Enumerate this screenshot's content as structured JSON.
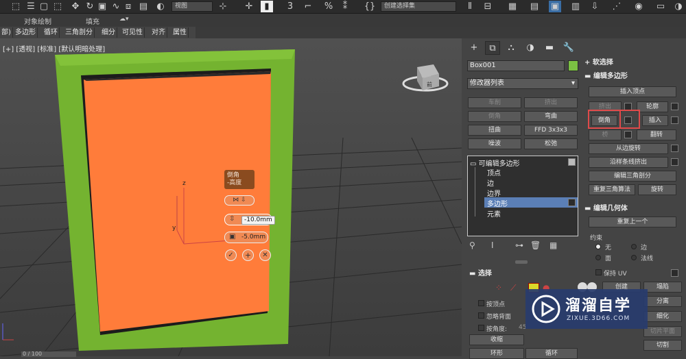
{
  "toolbar": {
    "view_dropdown": "视图",
    "selection_set": "创建选择集"
  },
  "ribbon": {
    "obj_paint": "对象绘制",
    "fill": "填充"
  },
  "ribbon_tabs": [
    "部)",
    "多边形",
    "循环",
    "三角剖分",
    "细分",
    "可见性",
    "对齐",
    "属性"
  ],
  "viewport": {
    "label": "[+] [透视] [标准] [默认明暗处理]",
    "caddy_title": "倒角\n-高度",
    "height_value": "-10.0mm",
    "outline_value": "-5.0mm",
    "axis_z": "z",
    "axis_y": "y",
    "cube_label": "前",
    "status_frame": "0 / 100"
  },
  "command_panel": {
    "object_name": "Box001",
    "object_color": "#7bc043",
    "modifier_list": "修改器列表",
    "mod_buttons": [
      "车削",
      "挤出",
      "倒角",
      "弯曲",
      "扭曲",
      "FFD 3x3x3",
      "噪波",
      "松弛"
    ],
    "stack": {
      "root": "可编辑多边形",
      "children": [
        "顶点",
        "边",
        "边界",
        "多边形",
        "元素"
      ],
      "selected": "多边形"
    },
    "select_title": "选择",
    "select_opts": [
      "按顶点",
      "忽略背面",
      "按角度:"
    ],
    "angle_value": "45",
    "shrink": "收缩",
    "ring": "环形",
    "loop": "循环"
  },
  "rollout": {
    "soft_select": "软选择",
    "edit_poly": "编辑多边形",
    "insert_vertex": "插入顶点",
    "extrude": "挤出",
    "outline": "轮廓",
    "bevel": "倒角",
    "inset": "插入",
    "bridge": "桥",
    "flip": "翻转",
    "hinge": "从边旋转",
    "extrude_spline": "沿样条线挤出",
    "edit_tri": "编辑三角剖分",
    "retri": "重复三角算法",
    "turn": "旋转",
    "edit_geom": "编辑几何体",
    "repeat_last": "重复上一个",
    "constraints": "约束",
    "c_none": "无",
    "c_edge": "边",
    "c_face": "面",
    "c_normal": "法线",
    "preserve_uv": "保持 UV",
    "create": "创建",
    "collapse": "塌陷",
    "detach": "分离",
    "slice_plane": "切片平面",
    "cut": "切割",
    "tess": "细化"
  },
  "watermark": {
    "brand": "溜溜自学",
    "url": "ZIXUE.3D66.COM"
  }
}
